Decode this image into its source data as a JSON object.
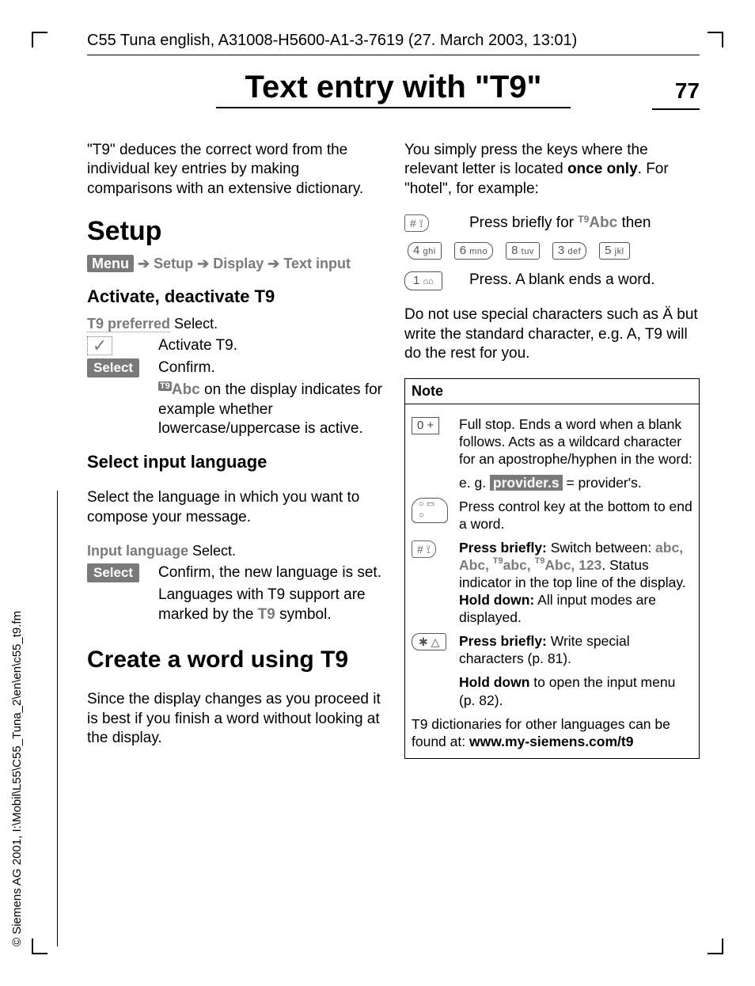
{
  "header": "C55 Tuna english, A31008-H5600-A1-3-7619 (27. March 2003, 13:01)",
  "title": "Text entry with \"T9\"",
  "pageNumber": "77",
  "left": {
    "intro": "\"T9\" deduces the correct word from the individual key entries by making comparisons with an extensive dictionary.",
    "setup": "Setup",
    "menu_chip": "Menu",
    "menu_path_1": "Setup",
    "menu_path_2": "Display",
    "menu_path_3": "Text input",
    "activate_h": "Activate, deactivate T9",
    "t9_pref": "T9 preferred",
    "t9_pref_after": " Select.",
    "activate_t9": "Activate T9.",
    "select_chip": "Select",
    "confirm": "Confirm.",
    "abc_disp_pre": "Abc",
    "abc_disp": " on the display indicates for example whether lowercase/uppercase is active.",
    "sel_lang_h": "Select input language",
    "sel_lang_p": "Select the language in which you want to compose your message.",
    "input_lang": "Input language",
    "input_lang_after": " Select.",
    "confirm_lang": "Confirm, the new language is set.",
    "lang_support": "Languages with T9 support are marked by the ",
    "t9_symbol": "T9",
    "lang_support2": " symbol.",
    "create_h": "Create a word using T9",
    "create_p": "Since the display changes as you proceed it is best if you finish a word without looking at the display."
  },
  "right": {
    "intro1": "You simply press the keys where the relevant letter is located ",
    "once_only": "once only",
    "intro2": ". For \"hotel\", for example:",
    "press_brief": "Press briefly for ",
    "t9abc": "T9Abc",
    "press_brief2": " then",
    "keys": [
      {
        "n": "4",
        "l": "ghi"
      },
      {
        "n": "6",
        "l": "mno"
      },
      {
        "n": "8",
        "l": "tuv"
      },
      {
        "n": "3",
        "l": "def"
      },
      {
        "n": "5",
        "l": "jkl"
      }
    ],
    "one_key": "1",
    "press_blank": "Press. A blank ends a word.",
    "special": "Do not use special characters such as Ä but write the standard character, e.g. A, T9 will do the rest for you.",
    "note": "Note",
    "zero": "0 +",
    "zero_txt": "Full stop. Ends a word when a blank follows. Acts as a wildcard character for an apostrophe/hyphen in the word:",
    "eg_pre": "e. g. ",
    "eg_chip": "provider.s",
    "eg_post": " = provider's.",
    "bottom_txt": "Press control key at the bottom to end a word.",
    "hash_txt1": "Press briefly:",
    "hash_txt2": " Switch between: ",
    "hash_modes": "abc, Abc, T9abc, T9Abc, 123",
    "hash_txt3": ". Status indicator in the top line of the display.",
    "hash_hold": "Hold down:",
    "hash_hold2": " All input modes are displayed.",
    "star_txt1": "Press briefly:",
    "star_txt2": " Write special characters (p. 81).",
    "star_hold1": "Hold down",
    "star_hold2": " to open the input menu (p. 82).",
    "dict1": "T9 dictionaries for other languages can be found at: ",
    "dict2": "www.my-siemens.com/t9"
  },
  "side": "© Siemens AG 2001, I:\\Mobil\\L55\\C55_Tuna_2\\en\\en\\c55_t9.fm"
}
